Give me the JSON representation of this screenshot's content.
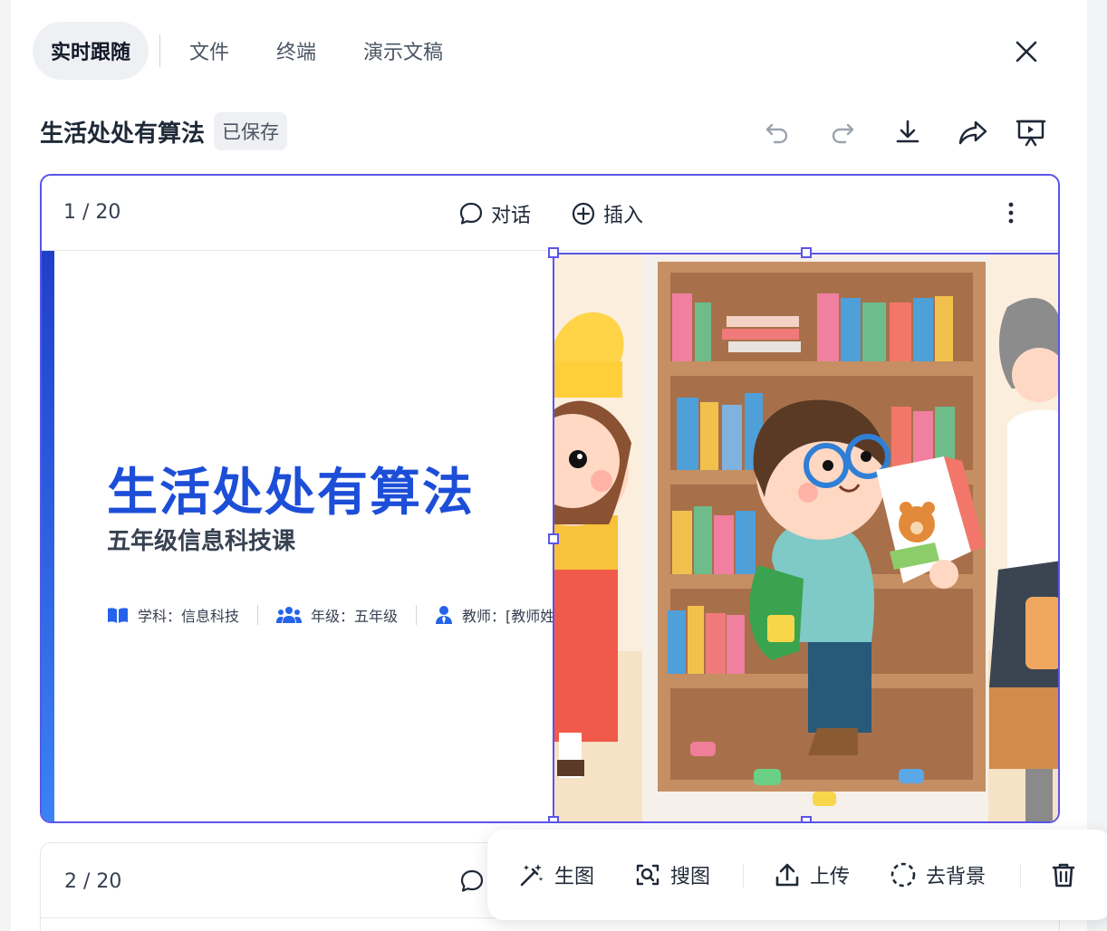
{
  "tabs": [
    {
      "label": "实时跟随",
      "active": true
    },
    {
      "label": "文件"
    },
    {
      "label": "终端"
    },
    {
      "label": "演示文稿"
    }
  ],
  "document": {
    "title": "生活处处有算法",
    "status": "已保存"
  },
  "toolbar_icons": [
    "undo-icon",
    "redo-icon",
    "download-icon",
    "share-icon",
    "present-icon"
  ],
  "slides": [
    {
      "page": "1 / 20",
      "actions": {
        "chat": "对话",
        "insert": "插入"
      },
      "title": "生活处处有算法",
      "subtitle": "五年级信息科技课",
      "meta": [
        {
          "icon": "book-icon",
          "text": "学科：信息科技"
        },
        {
          "icon": "users-icon",
          "text": "年级：五年级"
        },
        {
          "icon": "teacher-icon",
          "text": "教师：[教师姓名]"
        }
      ]
    },
    {
      "page": "2 / 20"
    }
  ],
  "image_toolbar": {
    "generate": "生图",
    "search": "搜图",
    "upload": "上传",
    "remove_bg": "去背景"
  },
  "colors": {
    "accent": "#5b55e8",
    "title_blue": "#1d4ed8"
  }
}
